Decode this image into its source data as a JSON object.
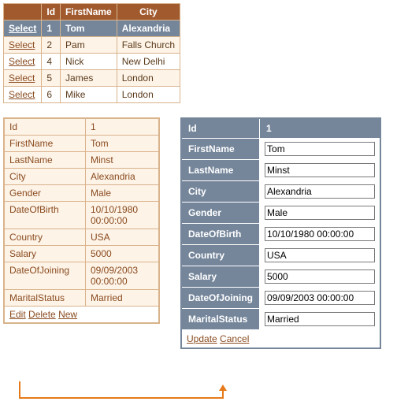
{
  "grid": {
    "headers": [
      "",
      "Id",
      "FirstName",
      "City"
    ],
    "select_label": "Select",
    "rows": [
      {
        "id": "1",
        "first": "Tom",
        "city": "Alexandria",
        "selected": true
      },
      {
        "id": "2",
        "first": "Pam",
        "city": "Falls Church",
        "selected": false
      },
      {
        "id": "4",
        "first": "Nick",
        "city": "New Delhi",
        "selected": false
      },
      {
        "id": "5",
        "first": "James",
        "city": "London",
        "selected": false
      },
      {
        "id": "6",
        "first": "Mike",
        "city": "London",
        "selected": false
      }
    ]
  },
  "details": {
    "fields": [
      {
        "label": "Id",
        "value": "1"
      },
      {
        "label": "FirstName",
        "value": "Tom"
      },
      {
        "label": "LastName",
        "value": "Minst"
      },
      {
        "label": "City",
        "value": "Alexandria"
      },
      {
        "label": "Gender",
        "value": "Male"
      },
      {
        "label": "DateOfBirth",
        "value": "10/10/1980 00:00:00"
      },
      {
        "label": "Country",
        "value": "USA"
      },
      {
        "label": "Salary",
        "value": "5000"
      },
      {
        "label": "DateOfJoining",
        "value": "09/09/2003 00:00:00"
      },
      {
        "label": "MaritalStatus",
        "value": "Married"
      }
    ],
    "actions": {
      "edit": "Edit",
      "delete": "Delete",
      "new": "New"
    }
  },
  "editor": {
    "header": {
      "id_label": "Id",
      "id_value": "1"
    },
    "fields": [
      {
        "label": "FirstName",
        "value": "Tom"
      },
      {
        "label": "LastName",
        "value": "Minst"
      },
      {
        "label": "City",
        "value": "Alexandria"
      },
      {
        "label": "Gender",
        "value": "Male"
      },
      {
        "label": "DateOfBirth",
        "value": "10/10/1980 00:00:00"
      },
      {
        "label": "Country",
        "value": "USA"
      },
      {
        "label": "Salary",
        "value": "5000"
      },
      {
        "label": "DateOfJoining",
        "value": "09/09/2003 00:00:00"
      },
      {
        "label": "MaritalStatus",
        "value": "Married"
      }
    ],
    "actions": {
      "update": "Update",
      "cancel": "Cancel"
    }
  }
}
